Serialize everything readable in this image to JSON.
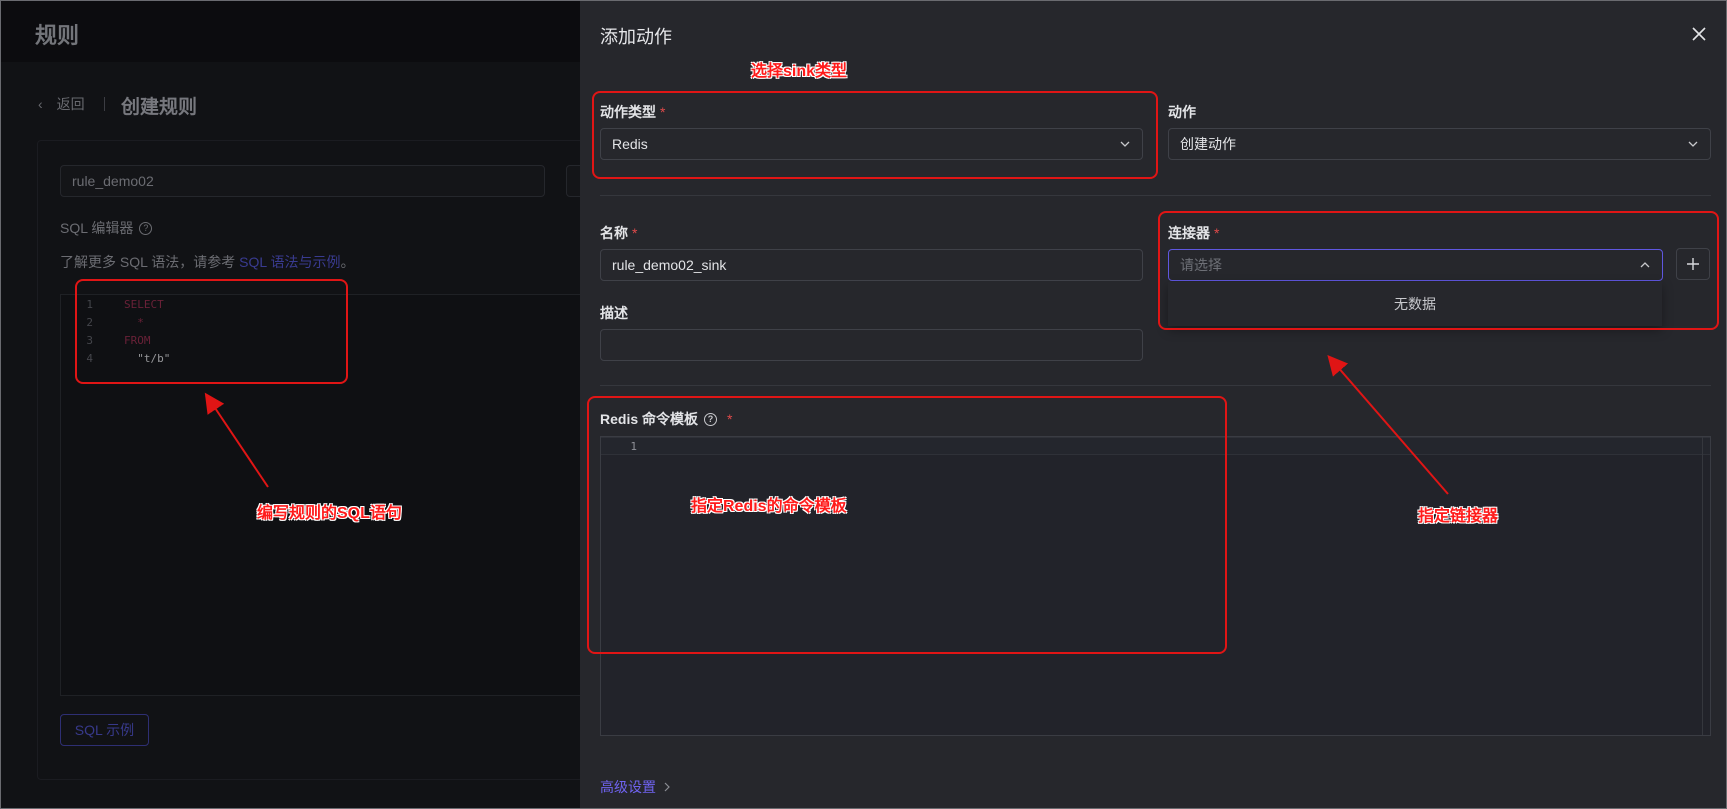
{
  "background": {
    "app_title": "规则",
    "back_label": "返回",
    "page_title": "创建规则",
    "rule_name_value": "rule_demo02",
    "sql_editor_label": "SQL 编辑器",
    "sql_help_prefix": "了解更多 SQL 语法，请参考",
    "sql_help_link": "SQL 语法与示例",
    "sql_help_suffix": "。",
    "sql_lines": [
      {
        "num": "1",
        "text": "SELECT",
        "kind": "keyword"
      },
      {
        "num": "2",
        "text": "  *",
        "kind": "text"
      },
      {
        "num": "3",
        "text": "FROM",
        "kind": "keyword"
      },
      {
        "num": "4",
        "text": "  \"t/b\"",
        "kind": "text"
      }
    ],
    "sql_example_button": "SQL 示例"
  },
  "drawer": {
    "title": "添加动作",
    "action_type_label": "动作类型",
    "action_type_value": "Redis",
    "action_label": "动作",
    "action_value": "创建动作",
    "name_label": "名称",
    "name_value": "rule_demo02_sink",
    "connector_label": "连接器",
    "connector_placeholder": "请选择",
    "connector_empty": "无数据",
    "description_label": "描述",
    "description_value": "",
    "redis_template_label": "Redis 命令模板",
    "redis_line_number": "1",
    "advanced_settings": "高级设置",
    "required_mark": "*"
  },
  "annotations": {
    "select_sink_type": "选择sink类型",
    "write_sql": "编写规则的SQL语句",
    "redis_template": "指定Redis的命令模板",
    "connector": "指定链接器",
    "color": "#e01515"
  },
  "colors": {
    "accent": "#6f63ef",
    "required": "#e04a4a",
    "drawer_bg": "#26272c"
  }
}
